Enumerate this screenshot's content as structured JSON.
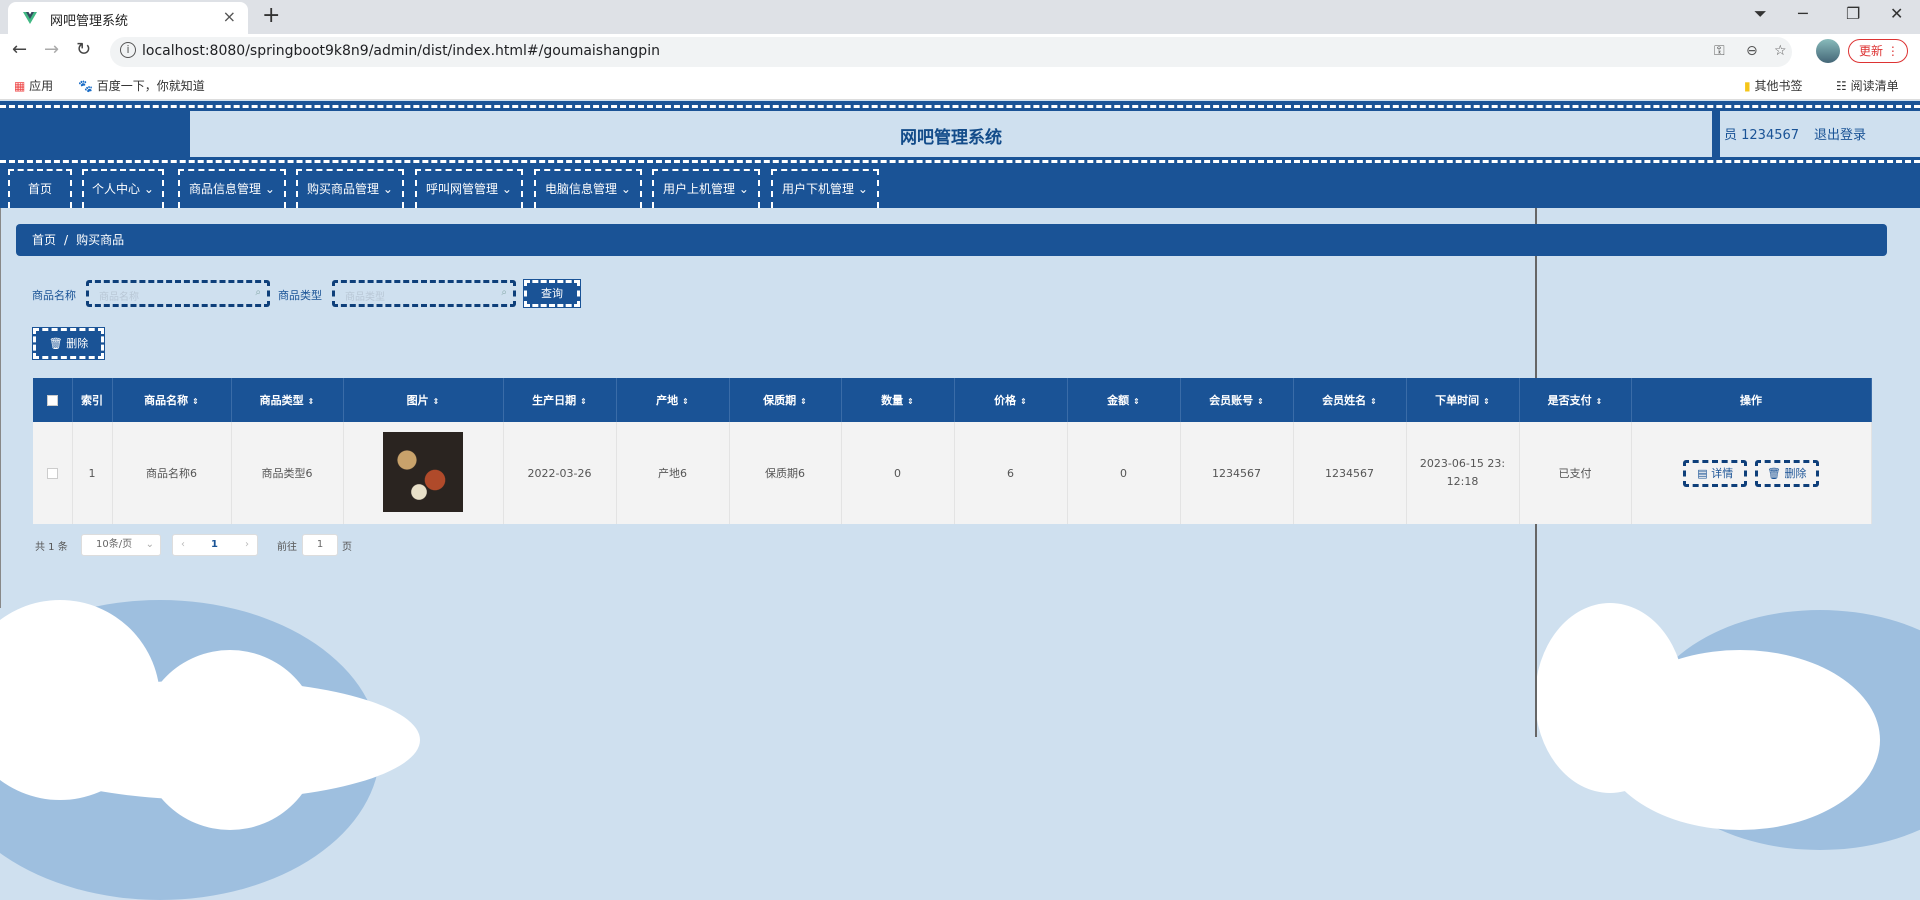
{
  "browser": {
    "tab_title": "网吧管理系统",
    "tab_close": "×",
    "new_tab": "+",
    "url": "localhost:8080/springboot9k8n9/admin/dist/index.html#/goumaishangpin",
    "update_label": "更新",
    "bookmarks": {
      "apps": "应用",
      "baidu": "百度一下，你就知道",
      "other": "其他书签",
      "reading": "阅读清单"
    }
  },
  "header": {
    "title": "网吧管理系统",
    "user": "员 1234567",
    "logout": "退出登录"
  },
  "menu": [
    "首页",
    "个人中心",
    "商品信息管理",
    "购买商品管理",
    "呼叫网管管理",
    "电脑信息管理",
    "用户上机管理",
    "用户下机管理"
  ],
  "breadcrumb": {
    "home": "首页",
    "sep": "/",
    "current": "购买商品"
  },
  "search": {
    "name_label": "商品名称",
    "name_placeholder": "商品名称",
    "type_label": "商品类型",
    "type_placeholder": "商品类型",
    "query_button": "查询"
  },
  "toolbar": {
    "delete_button": "删除"
  },
  "table": {
    "columns": [
      "索引",
      "商品名称",
      "商品类型",
      "图片",
      "生产日期",
      "产地",
      "保质期",
      "数量",
      "价格",
      "金额",
      "会员账号",
      "会员姓名",
      "下单时间",
      "是否支付",
      "操作"
    ],
    "rows": [
      {
        "index": "1",
        "name": "商品名称6",
        "type": "商品类型6",
        "date": "2022-03-26",
        "origin": "产地6",
        "shelf_life": "保质期6",
        "qty": "0",
        "price": "6",
        "amount": "0",
        "account": "1234567",
        "member_name": "1234567",
        "order_time": "2023-06-15 23:12:18",
        "paid": "已支付",
        "detail_btn": "详情",
        "delete_btn": "删除"
      }
    ]
  },
  "pagination": {
    "total": "共 1 条",
    "page_size": "10条/页",
    "current_page": "1",
    "goto_label": "前往",
    "goto_value": "1",
    "page_unit": "页"
  }
}
